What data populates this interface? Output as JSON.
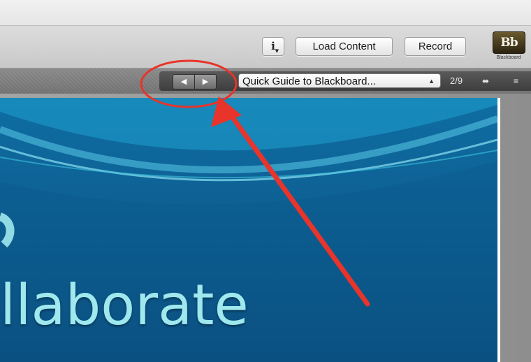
{
  "toolbar": {
    "info_label": "i",
    "load_content_label": "Load Content",
    "record_label": "Record"
  },
  "brand": {
    "logo_text": "Bb",
    "caption": "Blackboard"
  },
  "navigation": {
    "previous_glyph": "◀",
    "next_glyph": "▶",
    "selected_content": "Quick Guide to Blackboard...",
    "page_indicator": "2/9",
    "swap_glyph": "⬌",
    "list_glyph": "≡"
  },
  "slide": {
    "visible_text": "llaborate"
  },
  "colors": {
    "slide_background": "#0d5f92",
    "slide_text": "#9ee8ee",
    "annotation": "#e8342a"
  },
  "icons": {
    "info": "info-icon",
    "previous": "previous-arrow-icon",
    "next": "next-arrow-icon",
    "swap": "swap-arrows-icon",
    "list": "list-icon",
    "logo": "blackboard-logo-icon"
  }
}
